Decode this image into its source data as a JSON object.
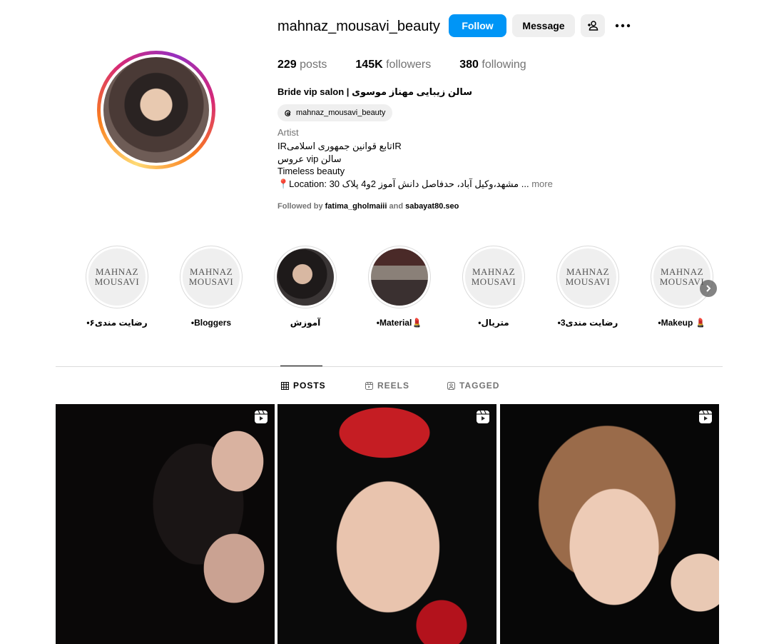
{
  "profile": {
    "username": "mahnaz_mousavi_beauty",
    "follow_label": "Follow",
    "message_label": "Message",
    "add_user_icon": "add-user-icon",
    "more_icon": "more-icon",
    "stats": [
      {
        "count": "229",
        "label": "posts"
      },
      {
        "count": "145K",
        "label": "followers"
      },
      {
        "count": "380",
        "label": "following"
      }
    ],
    "full_name": "Bride vip salon | سالن زیبایی مهناز موسوی",
    "threads_handle": "mahnaz_mousavi_beauty",
    "category": "Artist",
    "bio_lines": [
      "IRتابع قوانین جمهوری اسلامیIR",
      "عروس vip سالن",
      "Timeless beauty",
      "📍Location: مشهد،وکیل آباد، حدفاصل دانش آموز 2و4 پلاک 30 ..."
    ],
    "bio_more": "more",
    "followed_by_prefix": "Followed by",
    "followed_by_user1": "fatima_gholmaiii",
    "followed_by_and": "and",
    "followed_by_user2": "sabayat80.seo"
  },
  "highlights": [
    {
      "label": "•رضایت مندی۶",
      "cover_text1": "MAHNAZ",
      "cover_text2": "MOUSAVI"
    },
    {
      "label": "•Bloggers",
      "cover_text1": "MAHNAZ",
      "cover_text2": "MOUSAVI"
    },
    {
      "label": "آموزش",
      "cover_text1": "",
      "cover_text2": ""
    },
    {
      "label": "•Material💄",
      "cover_text1": "",
      "cover_text2": ""
    },
    {
      "label": "•متریال",
      "cover_text1": "MAHNAZ",
      "cover_text2": "MOUSAVI"
    },
    {
      "label": "•رضایت مندی3",
      "cover_text1": "MAHNAZ",
      "cover_text2": "MOUSAVI"
    },
    {
      "label": "•Makeup 💄",
      "cover_text1": "MAHNAZ",
      "cover_text2": "MOUSAVI"
    }
  ],
  "tabs": [
    {
      "label": "POSTS",
      "icon": "grid-icon"
    },
    {
      "label": "REELS",
      "icon": "reels-icon"
    },
    {
      "label": "TAGGED",
      "icon": "tagged-icon"
    }
  ],
  "posts": [
    {
      "type": "reel"
    },
    {
      "type": "reel"
    },
    {
      "type": "reel"
    }
  ],
  "colors": {
    "follow_button": "#0095f6",
    "secondary_button": "#efefef",
    "muted_text": "#737373",
    "divider": "#dbdbdb"
  }
}
